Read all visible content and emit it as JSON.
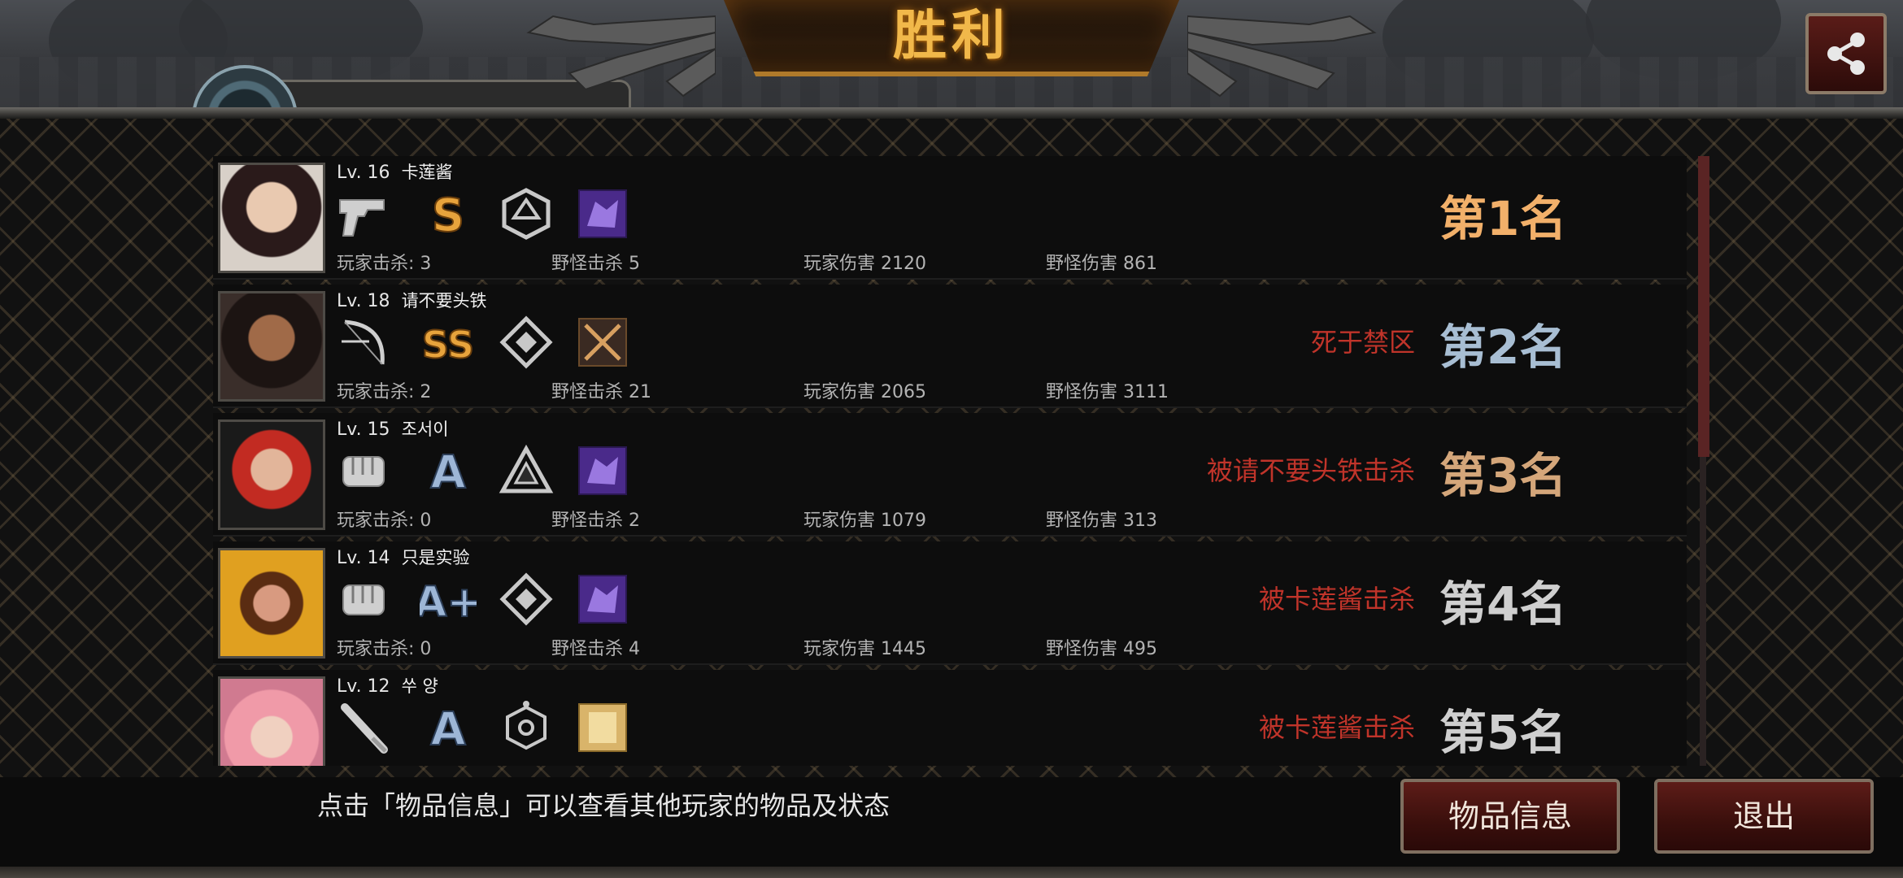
{
  "title": "胜利",
  "share_icon": "share-icon",
  "players": [
    {
      "level": "Lv. 16",
      "name": "卡莲酱",
      "weapon_icon": "pistol-icon",
      "grade": "S",
      "skill_icon": "hexagon-emblem-icon",
      "item_icon": "purple-beast-card-icon",
      "player_kills": "玩家击杀: 3",
      "monster_kills": "野怪击杀 5",
      "player_damage": "玩家伤害 2120",
      "monster_damage": "野怪伤害 861",
      "status": "",
      "rank": "第1名",
      "rank_color": "#f2b06a"
    },
    {
      "level": "Lv. 18",
      "name": "请不要头铁",
      "weapon_icon": "bow-icon",
      "grade": "SS",
      "skill_icon": "diamond-emblem-icon",
      "item_icon": "crossed-blades-card-icon",
      "player_kills": "玩家击杀: 2",
      "monster_kills": "野怪击杀 21",
      "player_damage": "玩家伤害 2065",
      "monster_damage": "野怪伤害 3111",
      "status": "死于禁区",
      "rank": "第2名",
      "rank_color": "#a8bed3"
    },
    {
      "level": "Lv. 15",
      "name": "조서이",
      "weapon_icon": "fist-icon",
      "grade": "A",
      "skill_icon": "triangle-emblem-icon",
      "item_icon": "purple-beast-card-icon",
      "player_kills": "玩家击杀: 0",
      "monster_kills": "野怪击杀 2",
      "player_damage": "玩家伤害 1079",
      "monster_damage": "野怪伤害 313",
      "status": "被请不要头铁击杀",
      "rank": "第3名",
      "rank_color": "#d4a67a"
    },
    {
      "level": "Lv. 14",
      "name": "只是实验",
      "weapon_icon": "fist-icon",
      "grade": "A+",
      "skill_icon": "diamond-emblem-icon",
      "item_icon": "purple-beast-card-icon",
      "player_kills": "玩家击杀: 0",
      "monster_kills": "野怪击杀 4",
      "player_damage": "玩家伤害 1445",
      "monster_damage": "野怪伤害 495",
      "status": "被卡莲酱击杀",
      "rank": "第4名",
      "rank_color": "#cfcfcf"
    },
    {
      "level": "Lv. 12",
      "name": "쑤 양",
      "weapon_icon": "bat-icon",
      "grade": "A",
      "skill_icon": "hex-node-emblem-icon",
      "item_icon": "gold-scroll-card-icon",
      "player_kills": "",
      "monster_kills": "",
      "player_damage": "",
      "monster_damage": "",
      "status": "被卡莲酱击杀",
      "rank": "第5名",
      "rank_color": "#cfcfcf"
    }
  ],
  "hint": "点击「物品信息」可以查看其他玩家的物品及状态",
  "buttons": {
    "item_info": "物品信息",
    "exit": "退出"
  }
}
